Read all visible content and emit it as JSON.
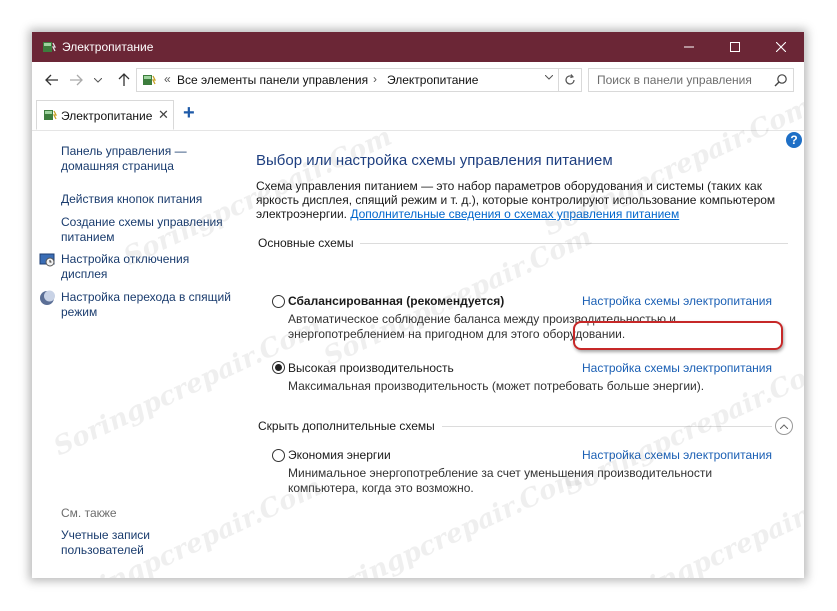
{
  "window": {
    "title": "Электропитание"
  },
  "address_bar": {
    "crumb_overflow": "«",
    "crumbs": [
      "Все элементы панели управления",
      "Электропитание"
    ],
    "search_placeholder": "Поиск в панели управления"
  },
  "tabs": [
    {
      "label": "Электропитание",
      "close": "✕"
    }
  ],
  "tab_add": "+",
  "help_label": "?",
  "sidebar": {
    "links": [
      "Панель управления — домашняя страница",
      "Действия кнопок питания",
      "Создание схемы управления питанием",
      "Настройка отключения дисплея",
      "Настройка перехода в спящий режим"
    ],
    "see_also_label": "См. также",
    "see_also_links": [
      "Учетные записи пользователей"
    ]
  },
  "main": {
    "heading": "Выбор или настройка схемы управления питанием",
    "description": "Схема управления питанием — это набор параметров оборудования и системы (таких как яркость дисплея, спящий режим и т. д.), которые контролируют использование компьютером электроэнергии. ",
    "description_link": "Дополнительные сведения о схемах управления питанием",
    "primary_section_label": "Основные схемы",
    "hidden_section_label": "Скрыть дополнительные схемы",
    "plans": [
      {
        "name": "Сбалансированная (рекомендуется)",
        "selected": false,
        "bold": true,
        "link": "Настройка схемы электропитания",
        "description": "Автоматическое соблюдение баланса между производительностью и энергопотреблением на пригодном для этого оборудовании."
      },
      {
        "name": "Высокая производительность",
        "selected": true,
        "bold": false,
        "link": "Настройка схемы электропитания",
        "description": "Максимальная производительность (может потребовать больше энергии)."
      },
      {
        "name": "Экономия энергии",
        "selected": false,
        "bold": false,
        "link": "Настройка схемы электропитания",
        "description": "Минимальное энергопотребление за счет уменьшения производительности компьютера, когда это возможно."
      }
    ]
  },
  "watermark_text": "Soringpcrepair.Com",
  "colors": {
    "titlebar": "#6b2636",
    "link": "#1a5fb4",
    "heading": "#1e3f80",
    "highlight": "#c62828"
  }
}
